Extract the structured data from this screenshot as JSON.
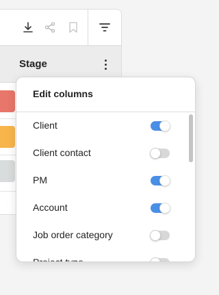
{
  "toolbar": {
    "icons": [
      "download-icon",
      "share-icon",
      "bookmark-icon",
      "filter-icon"
    ]
  },
  "table": {
    "stage_header": "Stage",
    "rows": [
      {
        "stage_color": "#e8766a"
      },
      {
        "stage_color": "#f7b54c"
      },
      {
        "stage_color": "#d9dcdc"
      }
    ]
  },
  "edit_columns": {
    "title": "Edit columns",
    "items": [
      {
        "label": "Client",
        "enabled": true
      },
      {
        "label": "Client contact",
        "enabled": false
      },
      {
        "label": "PM",
        "enabled": true
      },
      {
        "label": "Account",
        "enabled": true
      },
      {
        "label": "Job order category",
        "enabled": false
      },
      {
        "label": "Project type",
        "enabled": false
      }
    ]
  },
  "colors": {
    "toggle_on": "#4a8fe6",
    "toggle_off": "#d8d8d8"
  }
}
